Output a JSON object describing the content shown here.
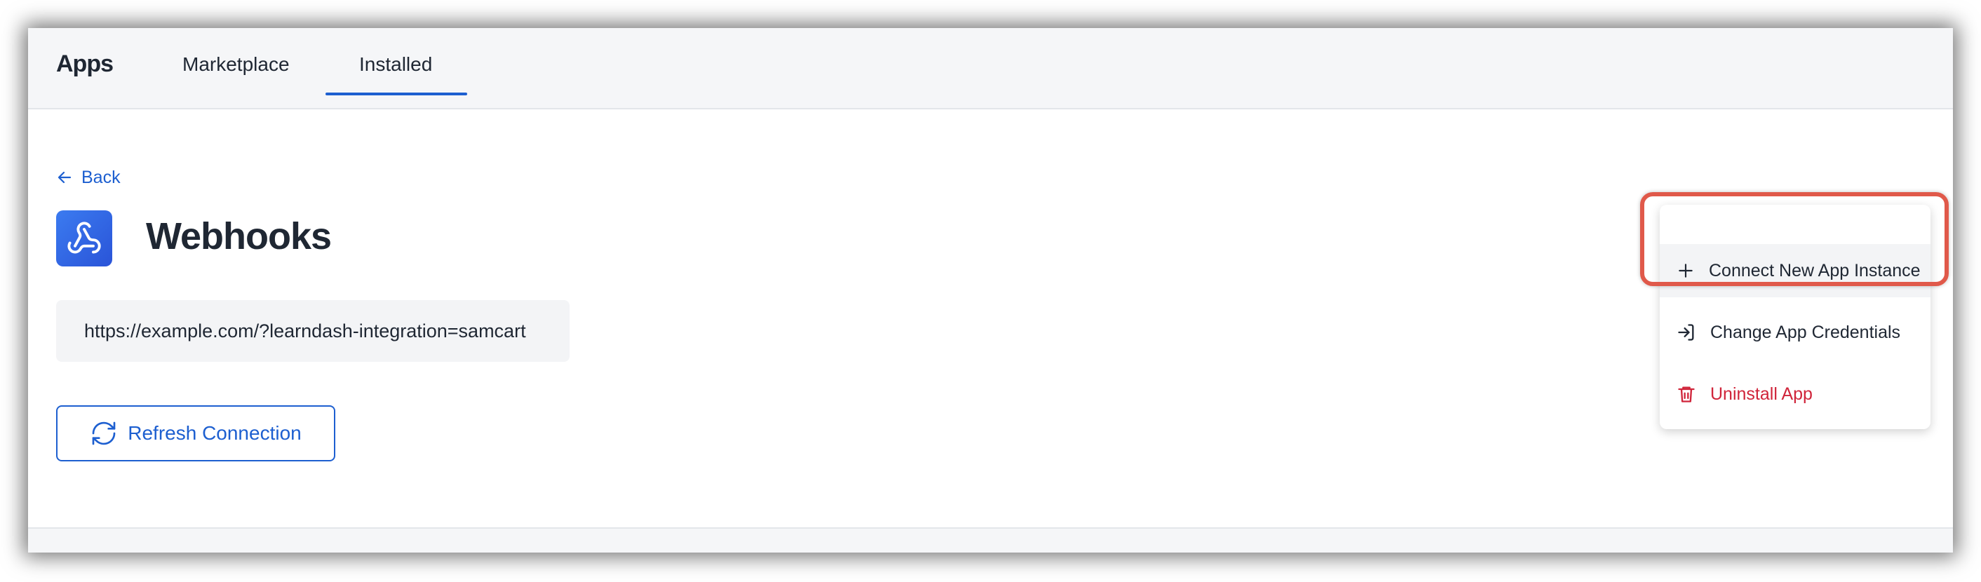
{
  "header": {
    "brand": "Apps",
    "tabs": [
      {
        "label": "Marketplace",
        "active": false
      },
      {
        "label": "Installed",
        "active": true
      }
    ]
  },
  "nav": {
    "back_label": "Back"
  },
  "app": {
    "title": "Webhooks",
    "icon": "webhook-icon",
    "url": "https://example.com/?learndash-integration=samcart",
    "refresh_label": "Refresh Connection"
  },
  "menu": {
    "items": [
      {
        "label": "Connect New App Instance",
        "icon": "plus-icon",
        "highlighted": true
      },
      {
        "label": "Change App Credentials",
        "icon": "login-arrow-icon"
      },
      {
        "label": "Uninstall App",
        "icon": "trash-icon",
        "danger": true
      }
    ]
  },
  "colors": {
    "accent": "#1d5fd0",
    "danger": "#d0243a",
    "callout": "#e0594a",
    "title": "#1f2733"
  }
}
